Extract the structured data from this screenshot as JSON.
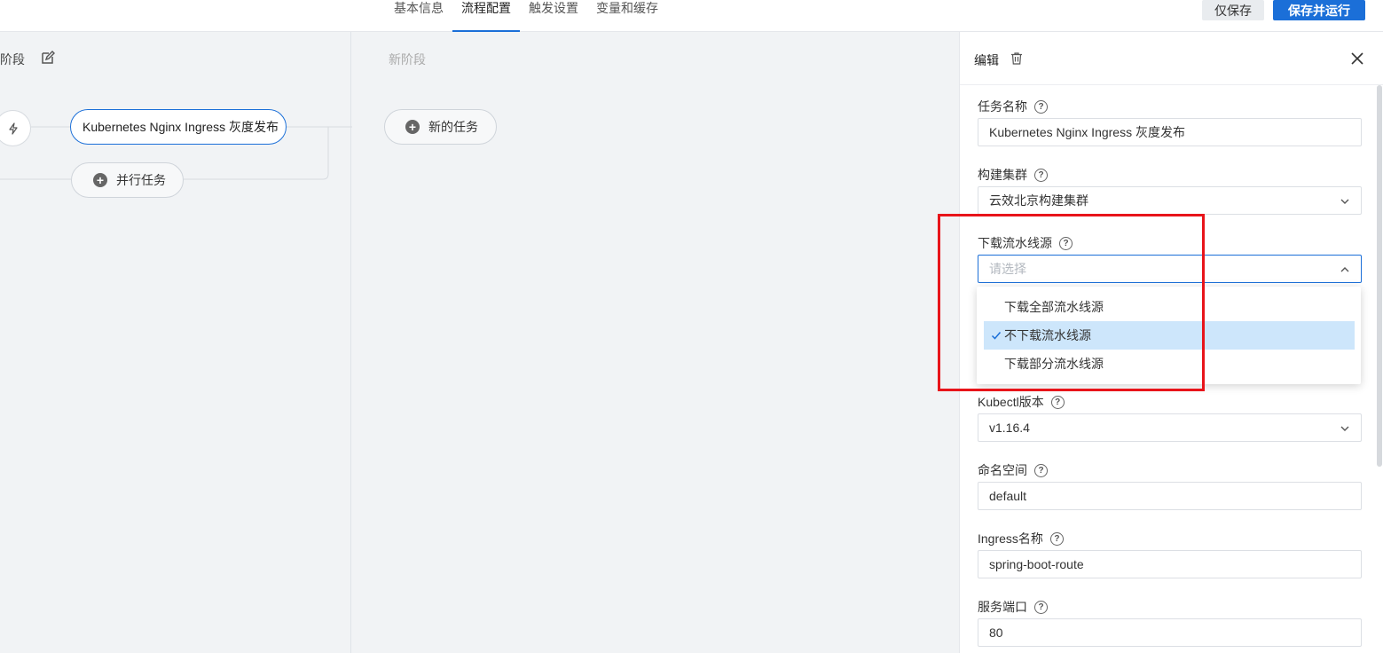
{
  "topbar": {
    "tabs": [
      "基本信息",
      "流程配置",
      "触发设置",
      "变量和缓存"
    ],
    "active_tab": "流程配置",
    "save_label": "仅保存",
    "run_label": "保存并运行"
  },
  "canvas": {
    "stage1_title": "新阶段",
    "stage1_title_visible": "新阶段",
    "stage2_title": "新阶段",
    "task_name": "Kubernetes Nginx Ingress 灰度发布",
    "parallel_task_label": "并行任务",
    "new_task_label": "新的任务"
  },
  "panel": {
    "title": "编辑",
    "fields": {
      "task_name": {
        "label": "任务名称",
        "value": "Kubernetes Nginx Ingress 灰度发布"
      },
      "build_cluster": {
        "label": "构建集群",
        "value": "云效北京构建集群"
      },
      "download_source": {
        "label": "下载流水线源",
        "placeholder": "请选择"
      },
      "kubectl_version": {
        "label": "Kubectl版本",
        "value": "v1.16.4"
      },
      "namespace": {
        "label": "命名空间",
        "value": "default"
      },
      "ingress_name": {
        "label": "Ingress名称",
        "value": "spring-boot-route"
      },
      "service_port": {
        "label": "服务端口",
        "value": "80"
      }
    },
    "dropdown_options": [
      "下载全部流水线源",
      "不下载流水线源",
      "下载部分流水线源"
    ],
    "dropdown_selected": "不下载流水线源"
  },
  "colors": {
    "accent": "#1b6fd8",
    "highlight": "#e8141a",
    "selected_option_bg": "#cde6fb"
  }
}
